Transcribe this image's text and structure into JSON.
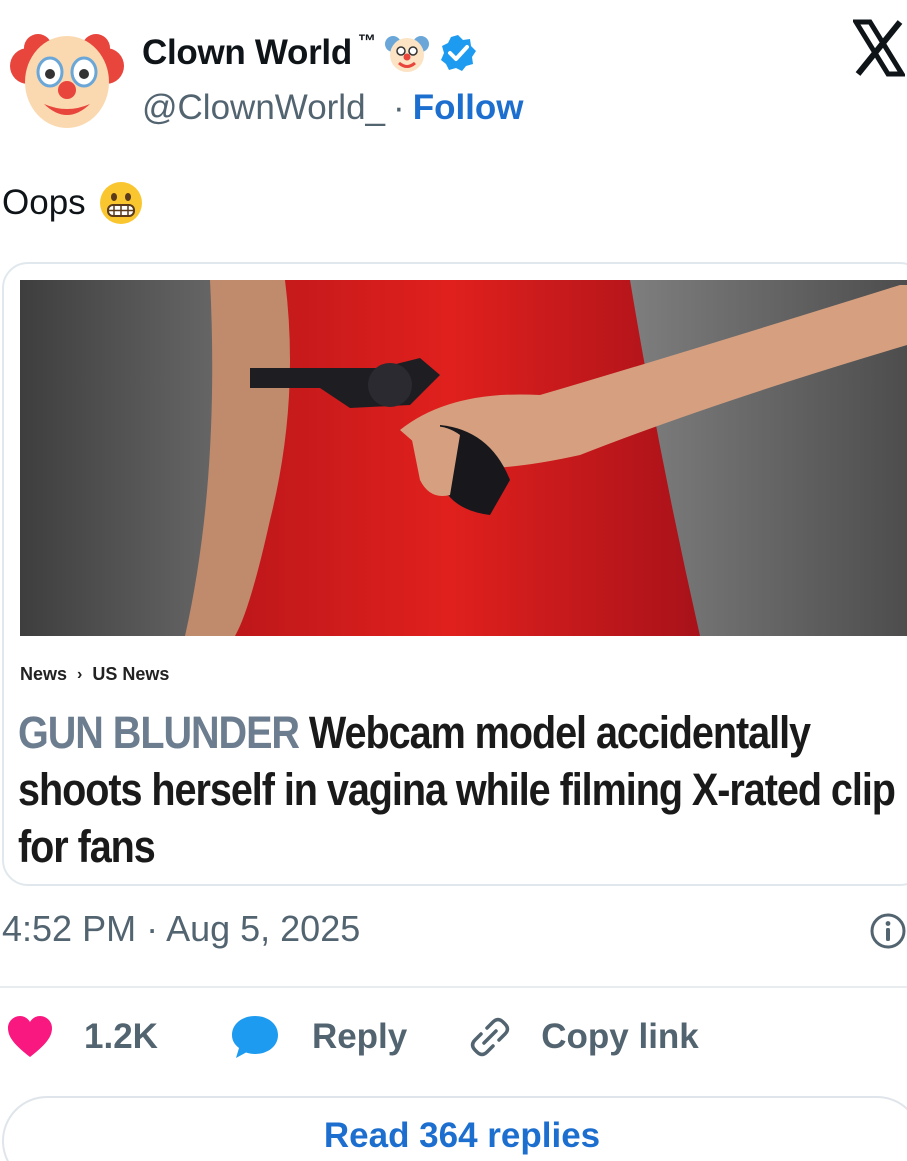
{
  "header": {
    "display_name": "Clown World",
    "tm": "™",
    "handle": "@ClownWorld_",
    "separator": "·",
    "follow_label": "Follow"
  },
  "tweet": {
    "text": "Oops"
  },
  "card": {
    "breadcrumb": [
      "News",
      "US News"
    ],
    "breadcrumb_sep": "›",
    "headline_kicker": "GUN BLUNDER",
    "headline_rest": " Webcam model accidentally shoots herself in vagina while filming X-rated clip for fans"
  },
  "meta": {
    "timestamp": "4:52 PM · Aug 5, 2025"
  },
  "actions": {
    "like_count": "1.2K",
    "reply_label": "Reply",
    "copy_link_label": "Copy link"
  },
  "footer": {
    "read_replies_label": "Read 364 replies"
  },
  "colors": {
    "accent": "#1d6fcf",
    "like": "#f91880",
    "reply": "#1d9bf0",
    "muted": "#536471",
    "kicker": "#6c7d90"
  },
  "icons": [
    "clown-avatar-icon",
    "clown-face-icon",
    "verified-badge-icon",
    "x-logo-icon",
    "grimacing-face-icon",
    "heart-icon",
    "reply-bubble-icon",
    "link-icon",
    "info-icon"
  ]
}
